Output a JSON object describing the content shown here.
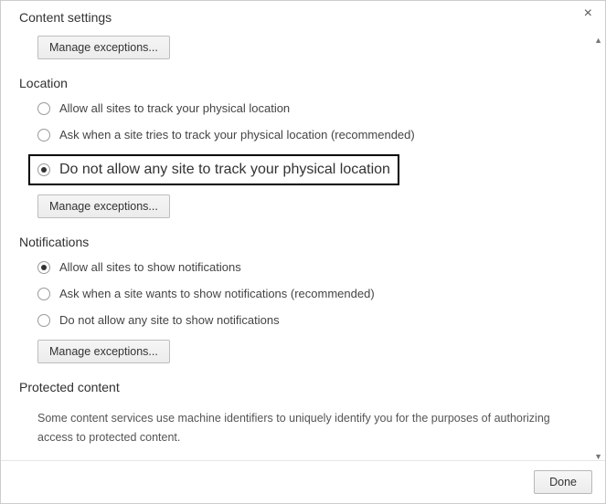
{
  "dialog": {
    "title": "Content settings",
    "close_glyph": "×"
  },
  "top_button": "Manage exceptions...",
  "location": {
    "title": "Location",
    "options": [
      "Allow all sites to track your physical location",
      "Ask when a site tries to track your physical location (recommended)",
      "Do not allow any site to track your physical location"
    ],
    "selected_index": 2,
    "manage": "Manage exceptions..."
  },
  "notifications": {
    "title": "Notifications",
    "options": [
      "Allow all sites to show notifications",
      "Ask when a site wants to show notifications (recommended)",
      "Do not allow any site to show notifications"
    ],
    "selected_index": 0,
    "manage": "Manage exceptions..."
  },
  "protected": {
    "title": "Protected content",
    "description": "Some content services use machine identifiers to uniquely identify you for the purposes of authorizing access to protected content."
  },
  "footer": {
    "done": "Done"
  }
}
